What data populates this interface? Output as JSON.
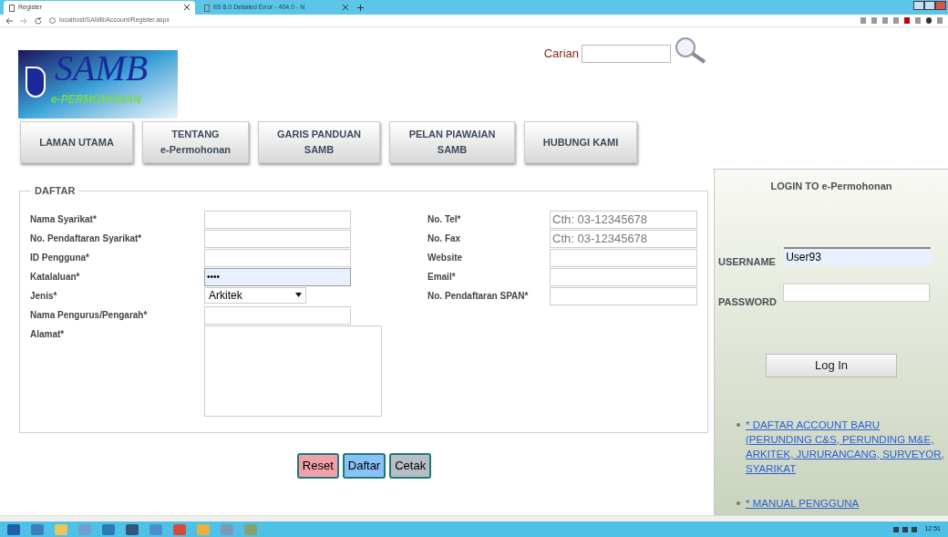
{
  "browser": {
    "tabs": [
      {
        "title": "Register",
        "selected": true
      },
      {
        "title": "IIS 8.0 Detailed Error - 404.0 - N",
        "selected": false
      }
    ],
    "url": "localhost/SAMB/Account/Register.aspx"
  },
  "logo": {
    "title": "SAMB",
    "subtitle": "e-PERMOHONAN"
  },
  "search": {
    "label": "Carian"
  },
  "nav": [
    {
      "lines": [
        "LAMAN UTAMA"
      ]
    },
    {
      "lines": [
        "TENTANG",
        "e-Permohonan"
      ]
    },
    {
      "lines": [
        "GARIS PANDUAN",
        "SAMB"
      ]
    },
    {
      "lines": [
        "PELAN PIAWAIAN",
        "SAMB"
      ]
    },
    {
      "lines": [
        "HUBUNGI KAMI"
      ]
    }
  ],
  "form": {
    "legend": "DAFTAR",
    "left_fields": [
      {
        "label": "Nama Syarikat*",
        "kind": "text"
      },
      {
        "label": "No. Pendaftaran Syarikat*",
        "kind": "text"
      },
      {
        "label": "ID Pengguna*",
        "kind": "text"
      },
      {
        "label": "Katalaluan*",
        "kind": "password",
        "value": "••••"
      },
      {
        "label": "Jenis*",
        "kind": "select",
        "value": "Arkitek"
      },
      {
        "label": "Nama Pengurus/Pengarah*",
        "kind": "text"
      },
      {
        "label": "Alamat*",
        "kind": "textarea"
      }
    ],
    "right_fields": [
      {
        "label": "No. Tel*",
        "kind": "text",
        "placeholder": "Cth: 03-12345678"
      },
      {
        "label": "No. Fax",
        "kind": "text",
        "placeholder": "Cth: 03-12345678"
      },
      {
        "label": "Website",
        "kind": "text"
      },
      {
        "label": "Email*",
        "kind": "text"
      },
      {
        "label": "No. Pendaftaran SPAN*",
        "kind": "text"
      }
    ]
  },
  "buttons": [
    {
      "label": "Reset",
      "color": "#f0a0a8"
    },
    {
      "label": "Daftar",
      "color": "#88c0f8"
    },
    {
      "label": "Cetak",
      "color": "#b8bcc4"
    }
  ],
  "login": {
    "title": "LOGIN TO e-Permohonan",
    "username": {
      "label": "USERNAME",
      "colon": ":",
      "value": "User93"
    },
    "password": {
      "label": "PASSWORD",
      "colon": ":"
    },
    "button": "Log In",
    "links": [
      "* DAFTAR ACCOUNT BARU (PERUNDING C&S, PERUNDING M&E, ARKITEK, JURURANCANG, SURVEYOR, SYARIKAT",
      "* MANUAL PENGGUNA"
    ]
  },
  "taskbar": {
    "clock": "12:51"
  }
}
